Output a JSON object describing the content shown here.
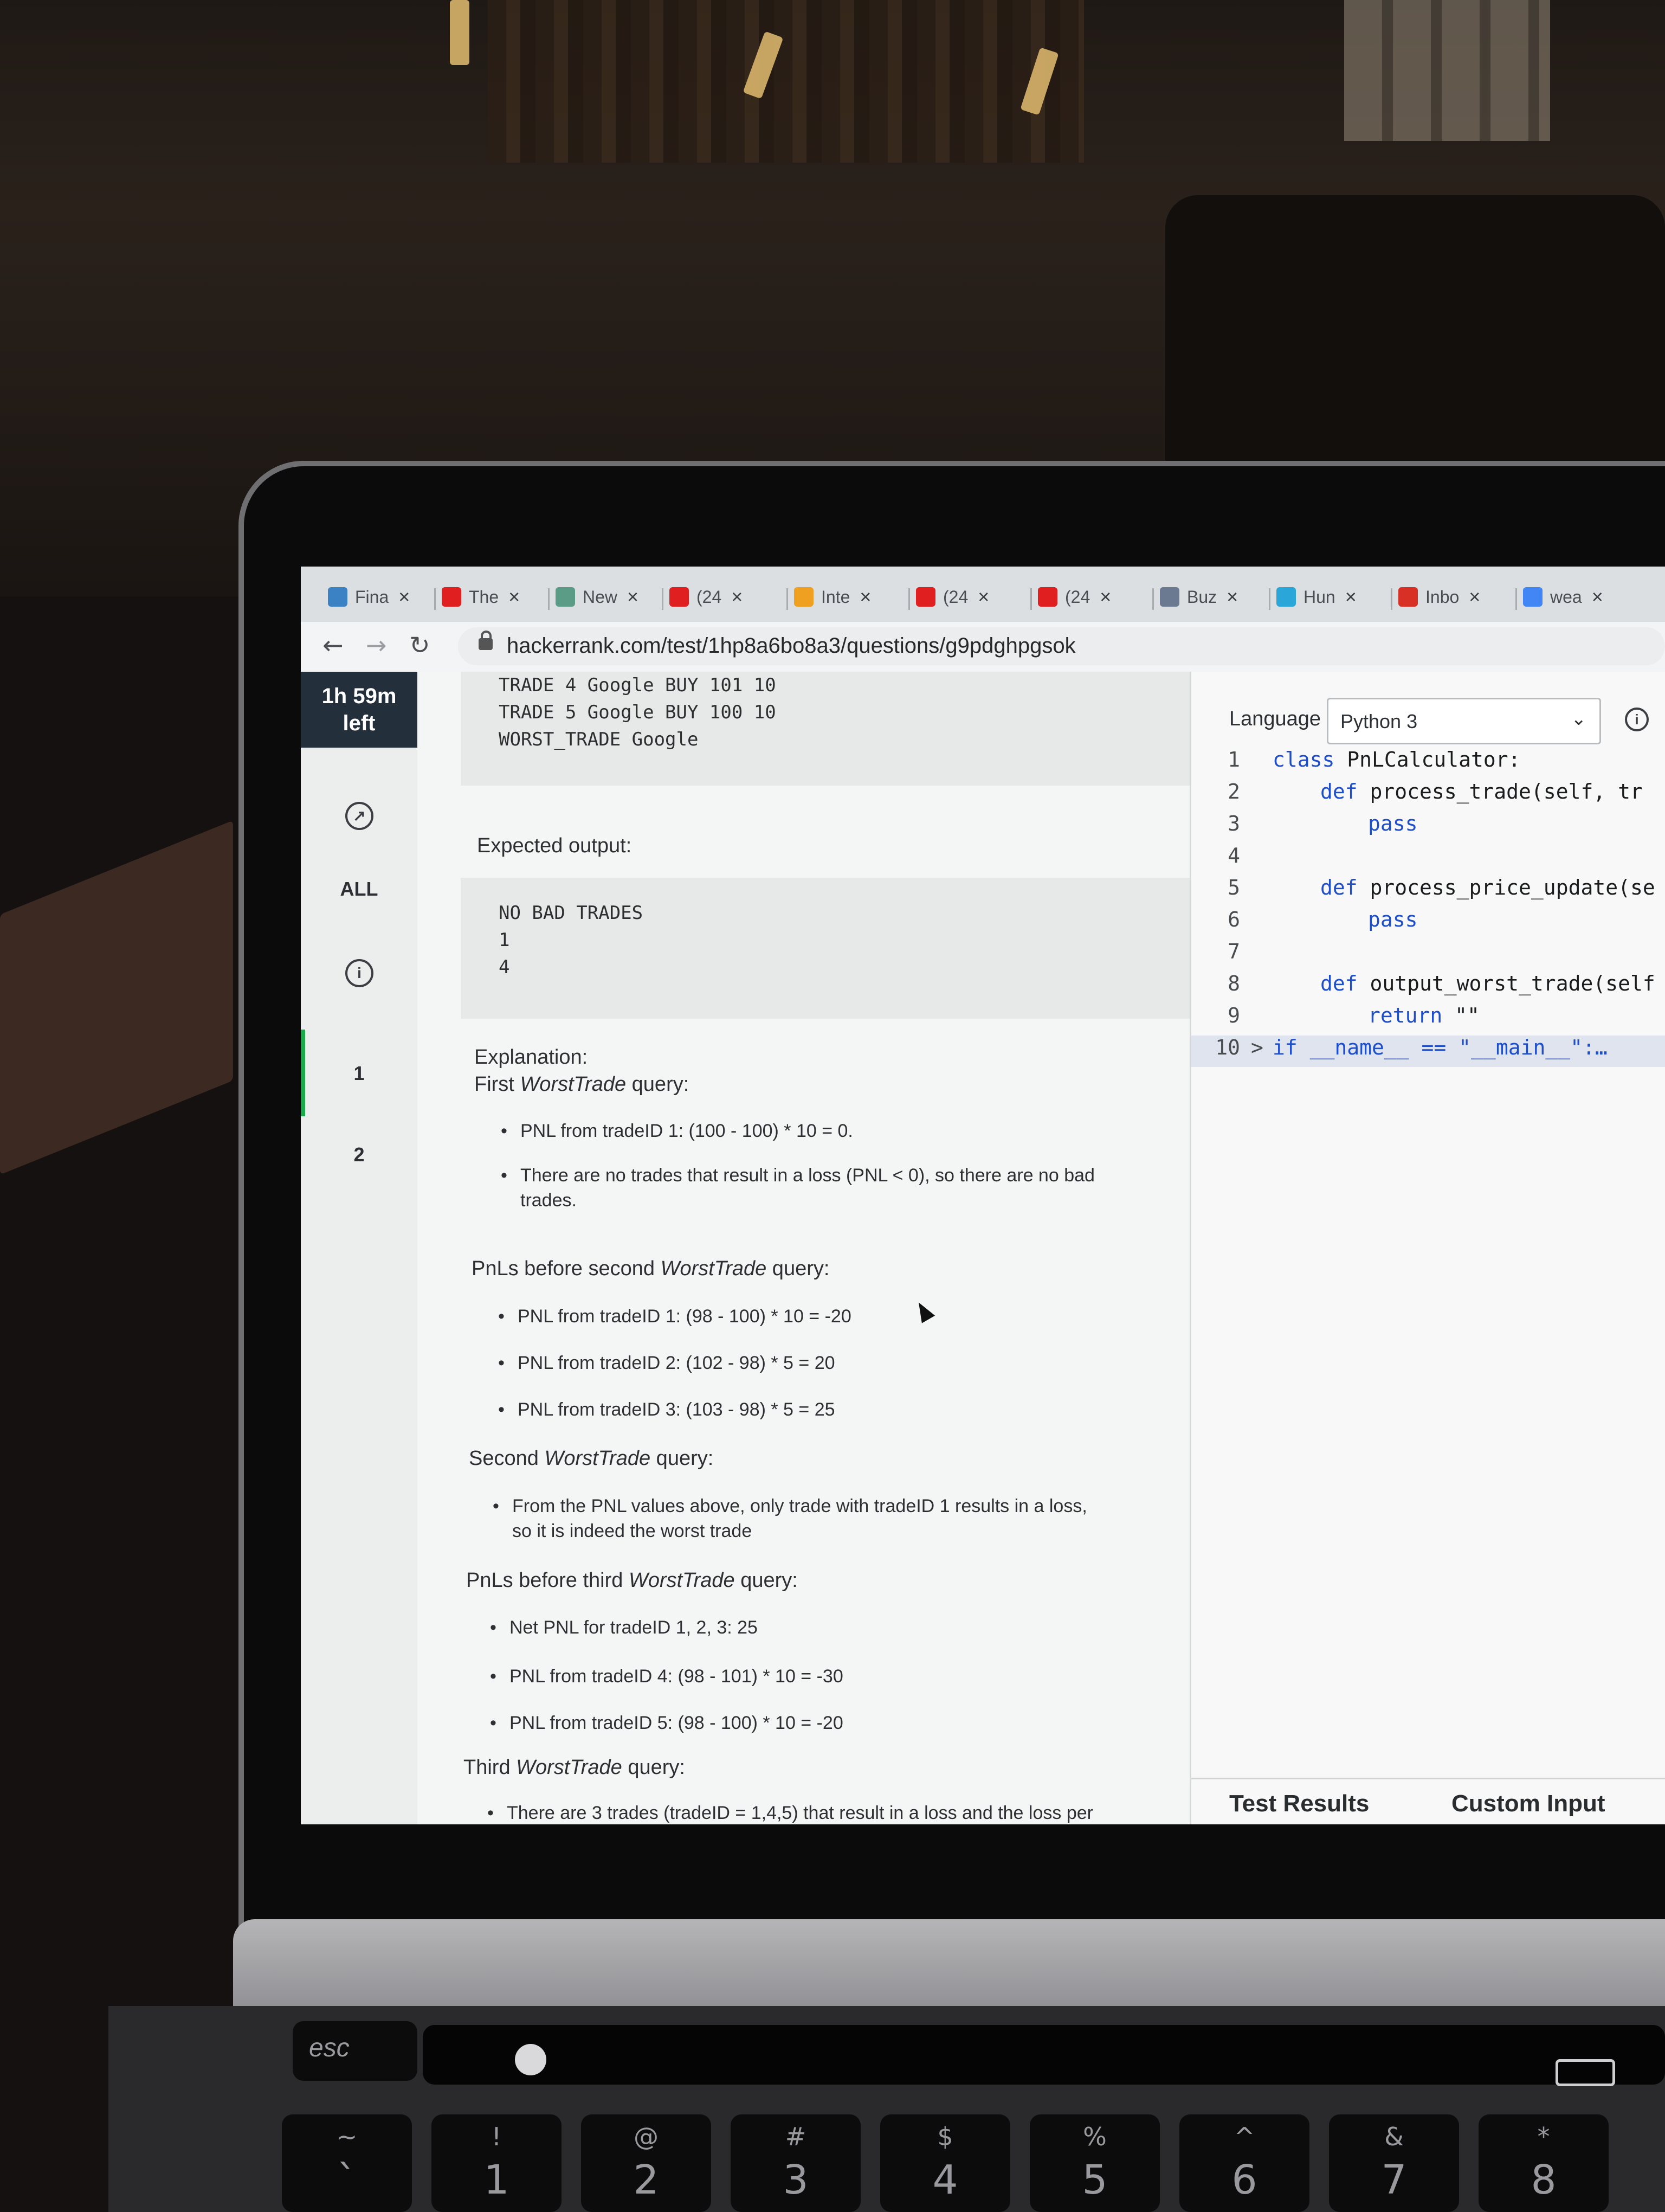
{
  "browser": {
    "tabs": [
      {
        "label": "Fina",
        "icon": "trello-icon",
        "color": "#3b82c4"
      },
      {
        "label": "The",
        "icon": "youtube-icon",
        "color": "#e02020"
      },
      {
        "label": "New",
        "icon": "openai-icon",
        "color": "#5b9c86"
      },
      {
        "label": "(24",
        "icon": "youtube-icon",
        "color": "#e02020"
      },
      {
        "label": "Inte",
        "icon": "reddit-icon",
        "color": "#f0a020"
      },
      {
        "label": "(24",
        "icon": "youtube-icon",
        "color": "#e02020"
      },
      {
        "label": "(24",
        "icon": "youtube-icon",
        "color": "#e02020"
      },
      {
        "label": "Buz",
        "icon": "buzz-icon",
        "color": "#6b7a90"
      },
      {
        "label": "Hun",
        "icon": "hunter-icon",
        "color": "#2aa7d8"
      },
      {
        "label": "Inbo",
        "icon": "gmail-icon",
        "color": "#d93025"
      },
      {
        "label": "wea",
        "icon": "google-icon",
        "color": "#4285f4"
      }
    ],
    "close_glyph": "×",
    "url": "hackerrank.com/test/1hp8a6bo8a3/questions/g9pdghpgsok"
  },
  "rail": {
    "timer_line1": "1h 59m",
    "timer_line2": "left",
    "all_label": "ALL",
    "info_glyph": "i",
    "q1": "1",
    "q2": "2"
  },
  "problem": {
    "input_lines": [
      "TRADE 4 Google BUY 101 10",
      "TRADE 5 Google BUY 100 10",
      "WORST_TRADE Google"
    ],
    "expected_label": "Expected output:",
    "expected_lines": [
      "NO BAD TRADES",
      "1",
      "4"
    ],
    "explanation_label": "Explanation:",
    "first_query_pre": "First ",
    "query_word": "WorstTrade",
    "query_post": " query:",
    "first_bullets": [
      "PNL from tradeID 1: (100 - 100) * 10 = 0.",
      "There are no trades that result in a loss (PNL < 0), so there are no bad",
      "trades."
    ],
    "second_pre": "PnLs before second ",
    "second_bullets": [
      "PNL from tradeID 1: (98 - 100) * 10 = -20",
      "PNL from tradeID 2: (102 - 98) * 5 = 20",
      "PNL from tradeID 3: (103 - 98) * 5 = 25"
    ],
    "second_query_pre": "Second ",
    "second_query_bullets": [
      "From the PNL values above, only trade with tradeID 1 results in a loss,",
      "so it is indeed the worst trade"
    ],
    "third_pre": "PnLs before third ",
    "third_bullets": [
      "Net PNL for tradeID 1, 2, 3: 25",
      "PNL from tradeID 4: (98 - 101) * 10 = -30",
      "PNL from tradeID 5: (98 - 100) * 10 = -20"
    ],
    "third_query_pre": "Third ",
    "third_query_bullets": [
      "There are 3 trades (tradeID = 1,4,5) that result in a loss and the loss per"
    ]
  },
  "editor": {
    "language_label": "Language",
    "language_value": "Python 3",
    "chevron": "⌄",
    "code": [
      {
        "n": "1",
        "indent": 0,
        "kw": "class",
        "rest": " PnLCalculator:"
      },
      {
        "n": "2",
        "indent": 1,
        "kw": "def",
        "rest": " process_trade(self, tr"
      },
      {
        "n": "3",
        "indent": 2,
        "kw": "pass",
        "rest": ""
      },
      {
        "n": "4",
        "indent": 0,
        "kw": "",
        "rest": ""
      },
      {
        "n": "5",
        "indent": 1,
        "kw": "def",
        "rest": " process_price_update(se"
      },
      {
        "n": "6",
        "indent": 2,
        "kw": "pass",
        "rest": ""
      },
      {
        "n": "7",
        "indent": 0,
        "kw": "",
        "rest": ""
      },
      {
        "n": "8",
        "indent": 1,
        "kw": "def",
        "rest": " output_worst_trade(self"
      },
      {
        "n": "9",
        "indent": 2,
        "kw": "return",
        "rest": " \"\""
      },
      {
        "n": "10",
        "indent": 0,
        "kw": "if",
        "rest": " __name__ == \"__main__\":…"
      }
    ],
    "fold_glyph": ">",
    "results_tab": "Test Results",
    "custom_tab": "Custom Input"
  },
  "keyboard": {
    "esc": "esc",
    "keys": [
      {
        "top": "~",
        "bot": "`"
      },
      {
        "top": "!",
        "bot": "1"
      },
      {
        "top": "@",
        "bot": "2"
      },
      {
        "top": "#",
        "bot": "3"
      },
      {
        "top": "$",
        "bot": "4"
      },
      {
        "top": "%",
        "bot": "5"
      },
      {
        "top": "^",
        "bot": "6"
      },
      {
        "top": "&",
        "bot": "7"
      },
      {
        "top": "*",
        "bot": "8"
      }
    ]
  }
}
